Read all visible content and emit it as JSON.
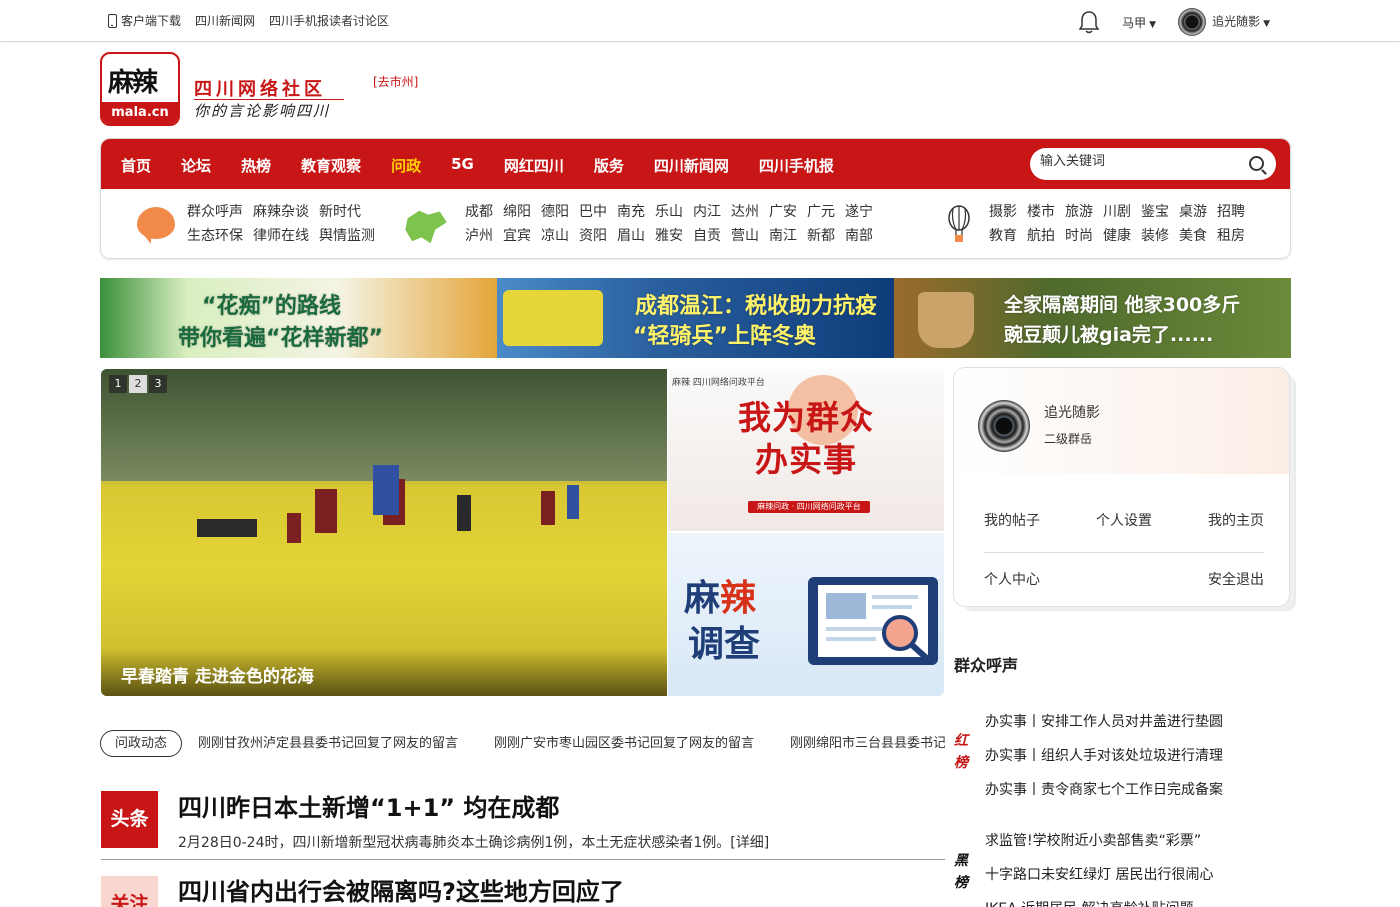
{
  "topbar": {
    "links": [
      "客户端下载",
      "四川新闻网",
      "四川手机报读者讨论区"
    ],
    "city": "马甲",
    "user": "追光随影"
  },
  "logo": {
    "zh": "麻辣",
    "en": "mala.cn",
    "title": "四川网络社区",
    "slogan": "你的言论影响四川",
    "city_tag": "[去市州]"
  },
  "nav": {
    "items": [
      "首页",
      "论坛",
      "热榜",
      "教育观察",
      "问政",
      "5G",
      "网红四川",
      "版务",
      "四川新闻网",
      "四川手机报"
    ],
    "active": "问政",
    "search_placeholder": "输入关键词"
  },
  "subnav": {
    "group1": {
      "row1": [
        "群众呼声",
        "麻辣杂谈",
        "新时代"
      ],
      "row2": [
        "生态环保",
        "律师在线",
        "舆情监测"
      ]
    },
    "group2": {
      "row1": [
        "成都",
        "绵阳",
        "德阳",
        "巴中",
        "南充",
        "乐山",
        "内江",
        "达州",
        "广安",
        "广元",
        "遂宁"
      ],
      "row2": [
        "泸州",
        "宜宾",
        "凉山",
        "资阳",
        "眉山",
        "雅安",
        "自贡",
        "营山",
        "南江",
        "新都",
        "南部"
      ]
    },
    "group3": {
      "row1": [
        "摄影",
        "楼市",
        "旅游",
        "川剧",
        "鉴宝",
        "桌游",
        "招聘"
      ],
      "row2": [
        "教育",
        "航拍",
        "时尚",
        "健康",
        "装修",
        "美食",
        "租房"
      ]
    }
  },
  "banners": [
    {
      "line1": "“花痴”的路线",
      "line2": "带你看遍“花样新都”"
    },
    {
      "line1": "成都温江：税收助力抗疫",
      "line2": "“轻骑兵”上阵冬奥"
    },
    {
      "line1": "全家隔离期间 他家300多斤",
      "line2": "豌豆颠儿被gia完了......"
    }
  ],
  "slider": {
    "pages": [
      "1",
      "2",
      "3"
    ],
    "active_page": "2",
    "caption": "早春踏青 走进金色的花海"
  },
  "promo1": {
    "mini": "麻辣 四川网络问政平台",
    "title": "我为群众办实事",
    "strip": "麻辣问政 · 四川网络问政平台"
  },
  "promo2": {
    "word1a": "麻",
    "word1b": "辣",
    "word2": "调查"
  },
  "user_card": {
    "name": "追光随影",
    "level": "二级群岳",
    "links_row1": [
      "我的帖子",
      "个人设置",
      "我的主页"
    ],
    "links_row2": [
      "个人中心",
      "安全退出"
    ]
  },
  "voice": {
    "title": "群众呼声",
    "red_label": "红榜",
    "black_label": "黑榜",
    "red_list": [
      "办实事丨安排工作人员对井盖进行垫圆",
      "办实事丨组织人手对该处垃圾进行清理",
      "办实事丨责令商家七个工作日完成备案"
    ],
    "black_list": [
      "求监管!学校附近小卖部售卖“彩票”",
      "十字路口未安红绿灯 居民出行很闹心",
      "IKEA 近期居民 解决高龄补贴问题"
    ]
  },
  "ticker": {
    "tag": "问政动态",
    "items": [
      "刚刚甘孜州泸定县县委书记回复了网友的留言",
      "刚刚广安市枣山园区委书记回复了网友的留言",
      "刚刚绵阳市三台县县委书记回复了网友的留言"
    ]
  },
  "headlines": [
    {
      "badge": "头条",
      "title": "四川昨日本土新增“1+1” 均在成都",
      "desc": "2月28日0-24时，四川新增新型冠状病毒肺炎本土确诊病例1例，本土无症状感染者1例。[详细]"
    },
    {
      "badge": "关注",
      "title": "四川省内出行会被隔离吗?这些地方回应了"
    }
  ]
}
